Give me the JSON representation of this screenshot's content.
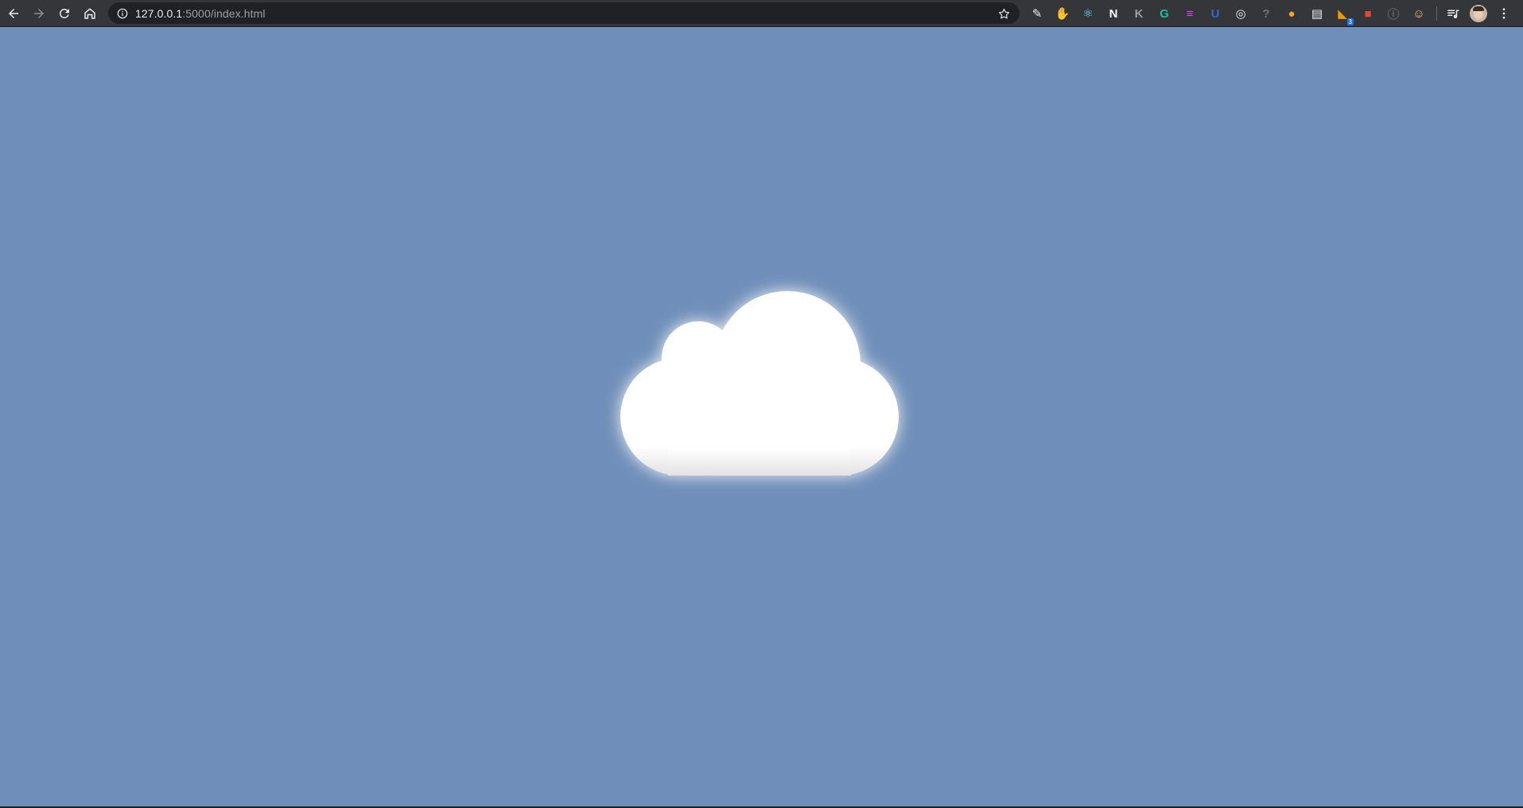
{
  "browser": {
    "url_host": "127.0.0.1",
    "url_path": ":5000/index.html",
    "icons": {
      "back": "arrow-left-icon",
      "forward": "arrow-right-icon",
      "reload": "reload-icon",
      "home": "home-icon",
      "site_info": "info-icon",
      "bookmark": "star-icon",
      "menu": "kebab-menu-icon"
    },
    "extensions": [
      {
        "name": "pen-extension-icon",
        "color": "#e8eaed",
        "glyph": "✎"
      },
      {
        "name": "stop-hand-extension-icon",
        "color": "#d93025",
        "glyph": "✋"
      },
      {
        "name": "react-devtools-extension-icon",
        "color": "#61dafb",
        "glyph": "⚛"
      },
      {
        "name": "notion-extension-icon",
        "color": "#ffffff",
        "glyph": "N"
      },
      {
        "name": "k-extension-icon",
        "color": "#9e9e9e",
        "glyph": "K"
      },
      {
        "name": "grammarly-extension-icon",
        "color": "#15c39a",
        "glyph": "G"
      },
      {
        "name": "list-extension-icon",
        "color": "#e040fb",
        "glyph": "≡"
      },
      {
        "name": "shield-extension-icon",
        "color": "#3367d6",
        "glyph": "U"
      },
      {
        "name": "target-extension-icon",
        "color": "#e8eaed",
        "glyph": "◎"
      },
      {
        "name": "unknown-extension-icon",
        "color": "#757575",
        "glyph": "?"
      },
      {
        "name": "octopus-extension-icon",
        "color": "#f5a623",
        "glyph": "●"
      },
      {
        "name": "calendar-extension-icon",
        "color": "#f1f3f4",
        "glyph": "▤"
      },
      {
        "name": "rss-extension-icon",
        "color": "#f29900",
        "glyph": "◣",
        "badge": "3"
      },
      {
        "name": "gift-extension-icon",
        "color": "#ea4335",
        "glyph": "■"
      },
      {
        "name": "info-extension-icon",
        "color": "#5f6368",
        "glyph": "ⓘ"
      },
      {
        "name": "face-extension-icon",
        "color": "#f0c27b",
        "glyph": "☺"
      }
    ]
  },
  "page": {
    "background": "#6f8eb9",
    "cloud_color": "#ffffff"
  }
}
